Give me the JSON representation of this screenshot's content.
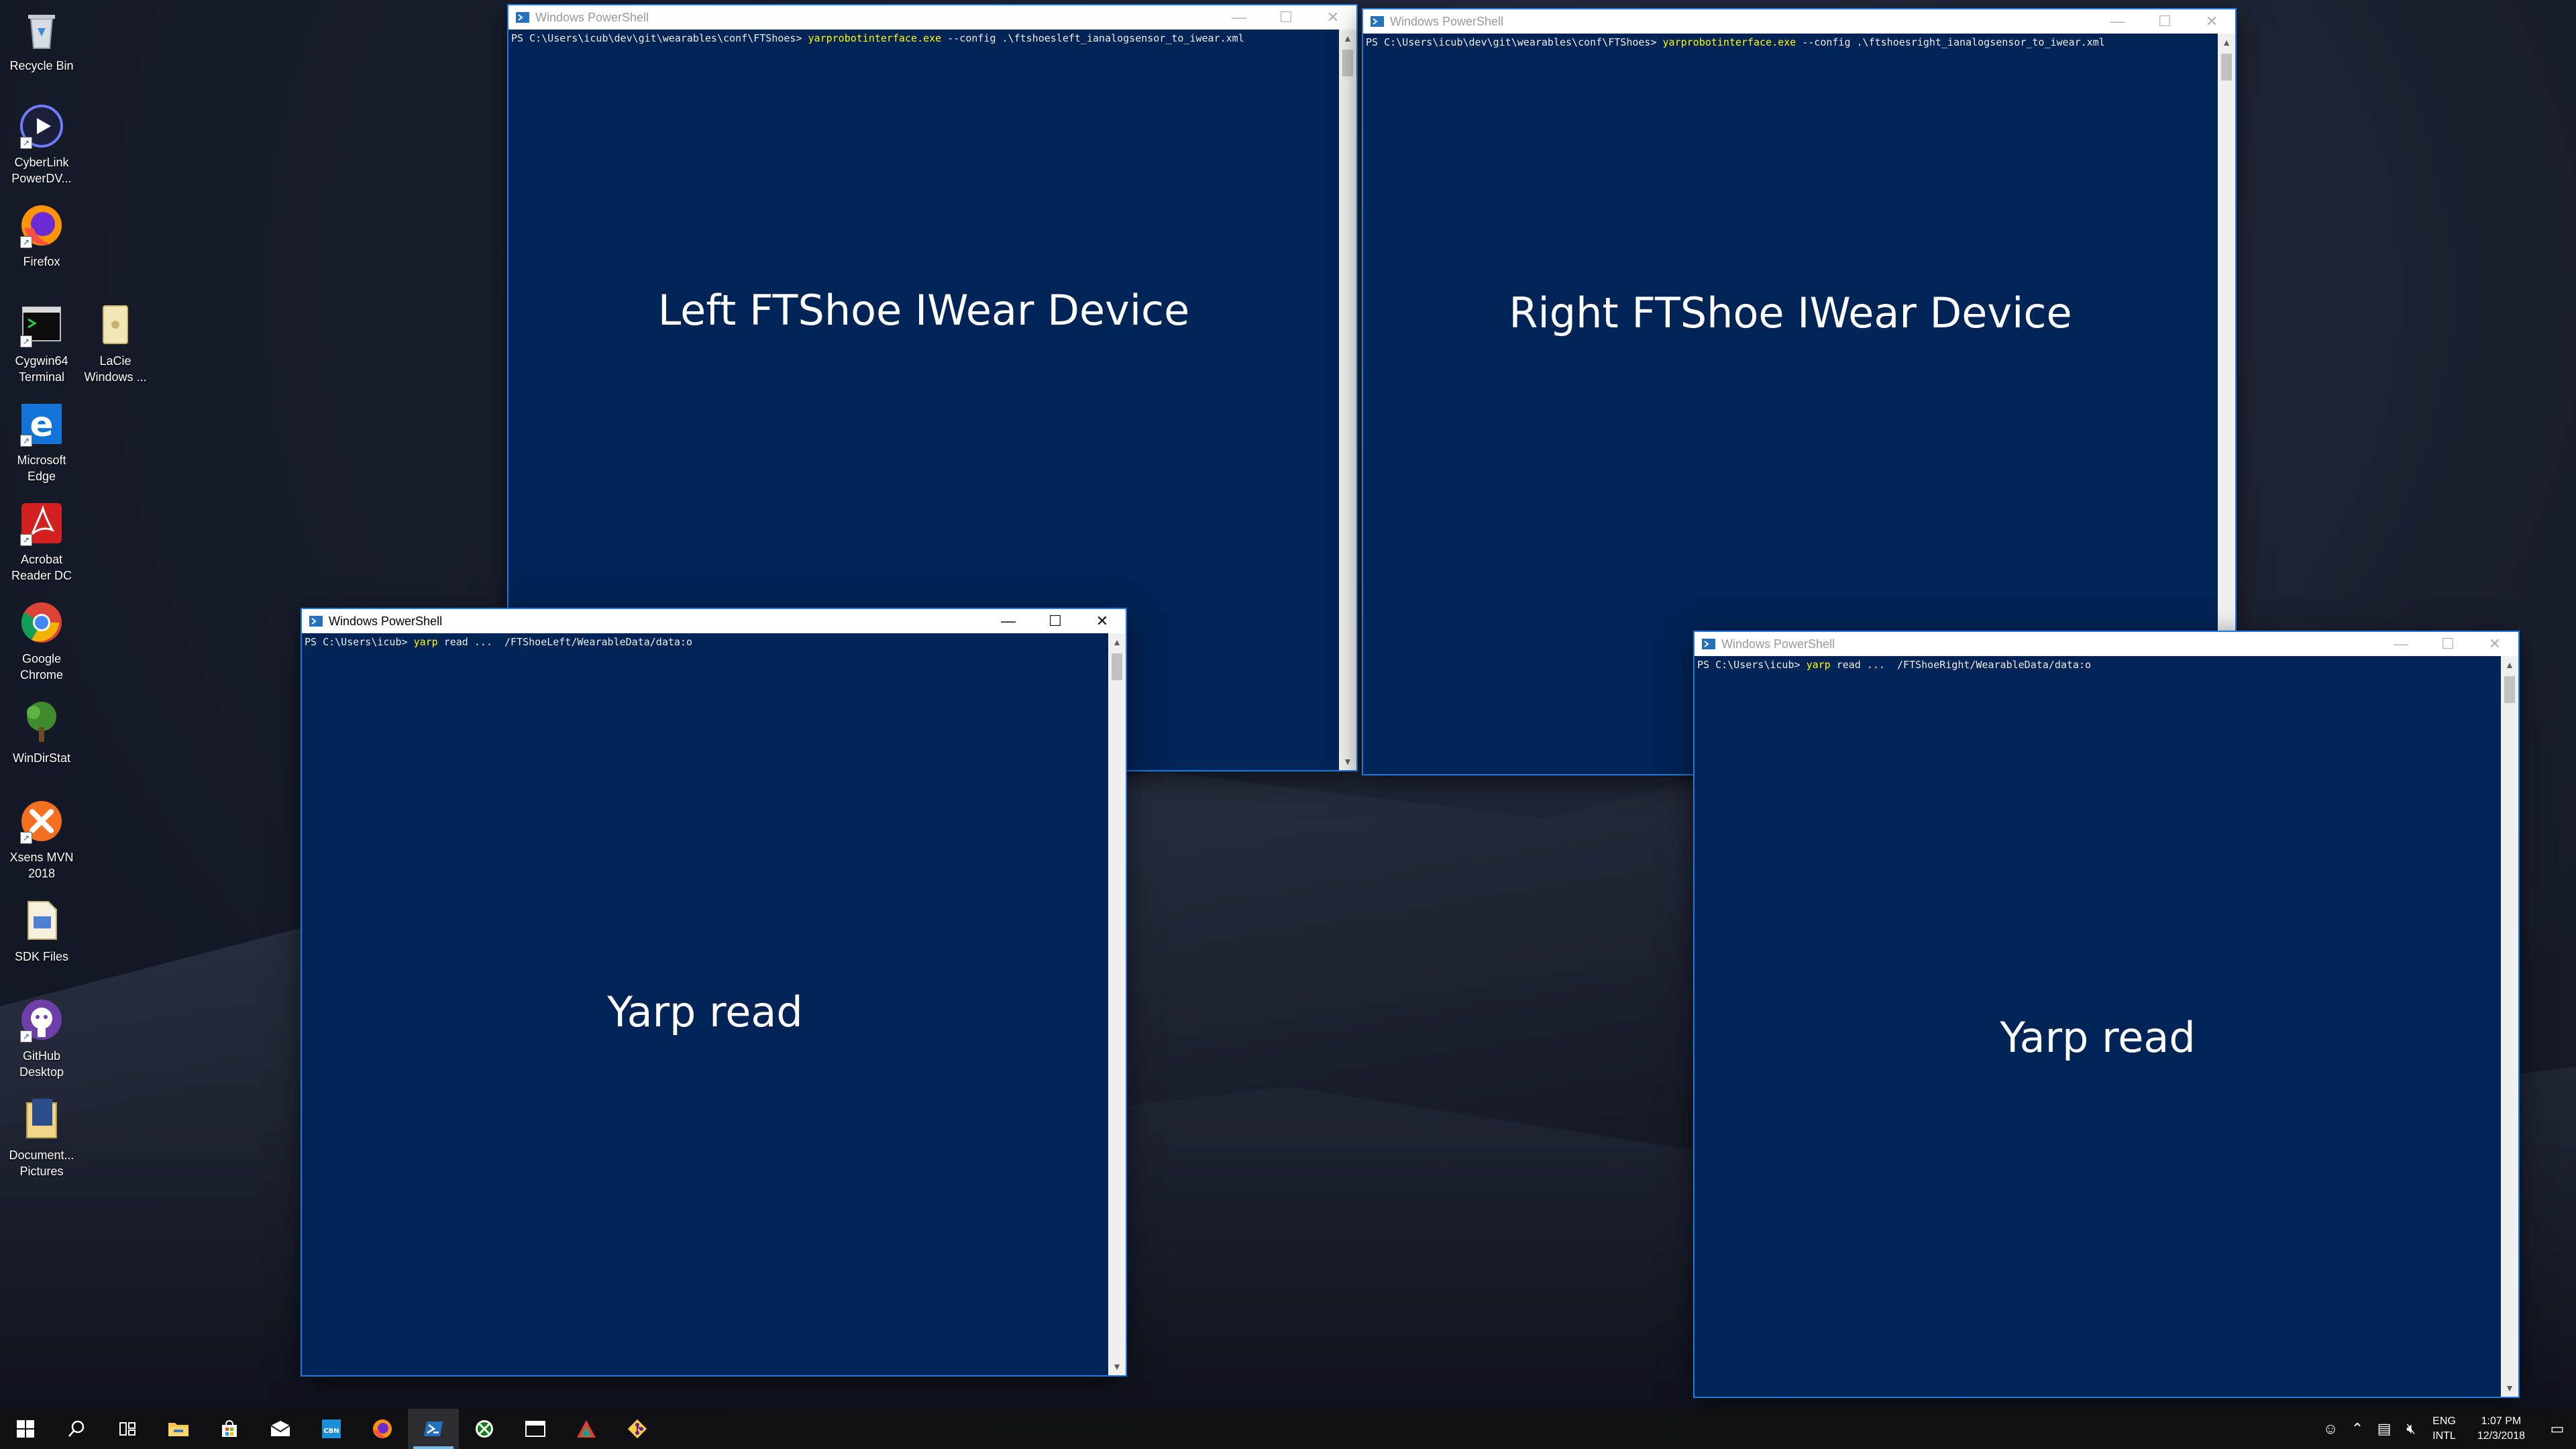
{
  "desktop": {
    "icons": [
      {
        "label": "Recycle Bin",
        "icon": "recycle-bin-icon"
      },
      {
        "label": "CyberLink PowerDV...",
        "icon": "cyberlink-icon"
      },
      {
        "label": "Firefox",
        "icon": "firefox-icon"
      },
      {
        "label": "Cygwin64 Terminal",
        "icon": "terminal-icon"
      },
      {
        "label": "LaCie Windows ...",
        "icon": "lacie-icon"
      },
      {
        "label": "Microsoft Edge",
        "icon": "edge-icon"
      },
      {
        "label": "Acrobat Reader DC",
        "icon": "acrobat-icon"
      },
      {
        "label": "Google Chrome",
        "icon": "chrome-icon"
      },
      {
        "label": "WinDirStat",
        "icon": "windirstat-icon"
      },
      {
        "label": "Xsens MVN 2018",
        "icon": "xsens-icon"
      },
      {
        "label": "SDK Files",
        "icon": "sdk-files-icon"
      },
      {
        "label": "GitHub Desktop",
        "icon": "github-icon"
      },
      {
        "label": "Document... Pictures",
        "icon": "documents-icon"
      }
    ]
  },
  "windows": [
    {
      "title": "Windows PowerShell",
      "prompt": "PS C:\\Users\\icub\\dev\\git\\wearables\\conf\\FTShoes>",
      "command": "yarprobotinterface.exe",
      "args": " --config .\\ftshoesleft_ianalogsensor_to_iwear.xml",
      "overlay": "Left FTShoe IWear Device",
      "controls": {
        "minimize": "—",
        "maximize": "☐",
        "close": "✕"
      }
    },
    {
      "title": "Windows PowerShell",
      "prompt": "PS C:\\Users\\icub\\dev\\git\\wearables\\conf\\FTShoes>",
      "command": "yarprobotinterface.exe",
      "args": " --config .\\ftshoesright_ianalogsensor_to_iwear.xml",
      "overlay": "Right FTShoe IWear Device",
      "controls": {
        "minimize": "—",
        "maximize": "☐",
        "close": "✕"
      }
    },
    {
      "title": "Windows PowerShell",
      "prompt": "PS C:\\Users\\icub>",
      "command": "yarp",
      "args": " read ...  /FTShoeLeft/WearableData/data:o",
      "overlay": "Yarp read",
      "controls": {
        "minimize": "—",
        "maximize": "☐",
        "close": "✕"
      }
    },
    {
      "title": "Windows PowerShell",
      "prompt": "PS C:\\Users\\icub>",
      "command": "yarp",
      "args": " read ...  /FTShoeRight/WearableData/data:o",
      "overlay": "Yarp read",
      "controls": {
        "minimize": "—",
        "maximize": "☐",
        "close": "✕"
      }
    }
  ],
  "taskbar": {
    "items": [
      {
        "icon": "start-icon",
        "active": false
      },
      {
        "icon": "search-icon",
        "active": false
      },
      {
        "icon": "task-view-icon",
        "active": false
      },
      {
        "icon": "file-explorer-icon",
        "active": false
      },
      {
        "icon": "store-icon",
        "active": false
      },
      {
        "icon": "mail-icon",
        "active": false
      },
      {
        "icon": "cbn-app-icon",
        "active": false
      },
      {
        "icon": "firefox-icon",
        "active": false
      },
      {
        "icon": "powershell-icon",
        "active": true
      },
      {
        "icon": "xbox-icon",
        "active": false
      },
      {
        "icon": "window-icon",
        "active": false
      },
      {
        "icon": "triangle-app-icon",
        "active": false
      },
      {
        "icon": "git-icon",
        "active": false
      }
    ],
    "tray": {
      "language_top": "ENG",
      "language_bottom": "INTL",
      "time": "1:07 PM",
      "date": "12/3/2018"
    }
  }
}
